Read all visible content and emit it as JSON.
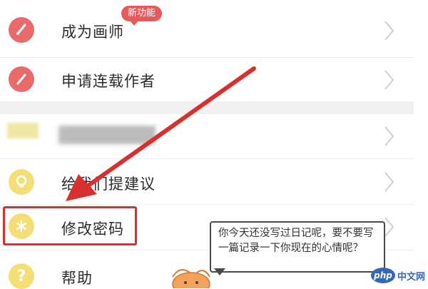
{
  "menu": {
    "items": [
      {
        "label": "成为画师",
        "icon": "brush-icon",
        "badge": "新功能"
      },
      {
        "label": "申请连载作者",
        "icon": "pen-icon"
      },
      {
        "label": "",
        "icon": "blurred-icon"
      },
      {
        "label": "给我们提建议",
        "icon": "lightbulb-icon"
      },
      {
        "label": "修改密码",
        "icon": "asterisk-icon"
      },
      {
        "label": "帮助",
        "icon": "question-icon"
      }
    ]
  },
  "bubble": {
    "text": "你今天还没写过日记呢，要不要写一篇记录一下你现在的心情呢？"
  },
  "watermark": {
    "logo": "php",
    "text": "中文网"
  },
  "colors": {
    "icon_red": "#e86a6a",
    "icon_yellow": "#f4df76",
    "highlight": "#d9302f",
    "badge": "#e85a5a"
  }
}
